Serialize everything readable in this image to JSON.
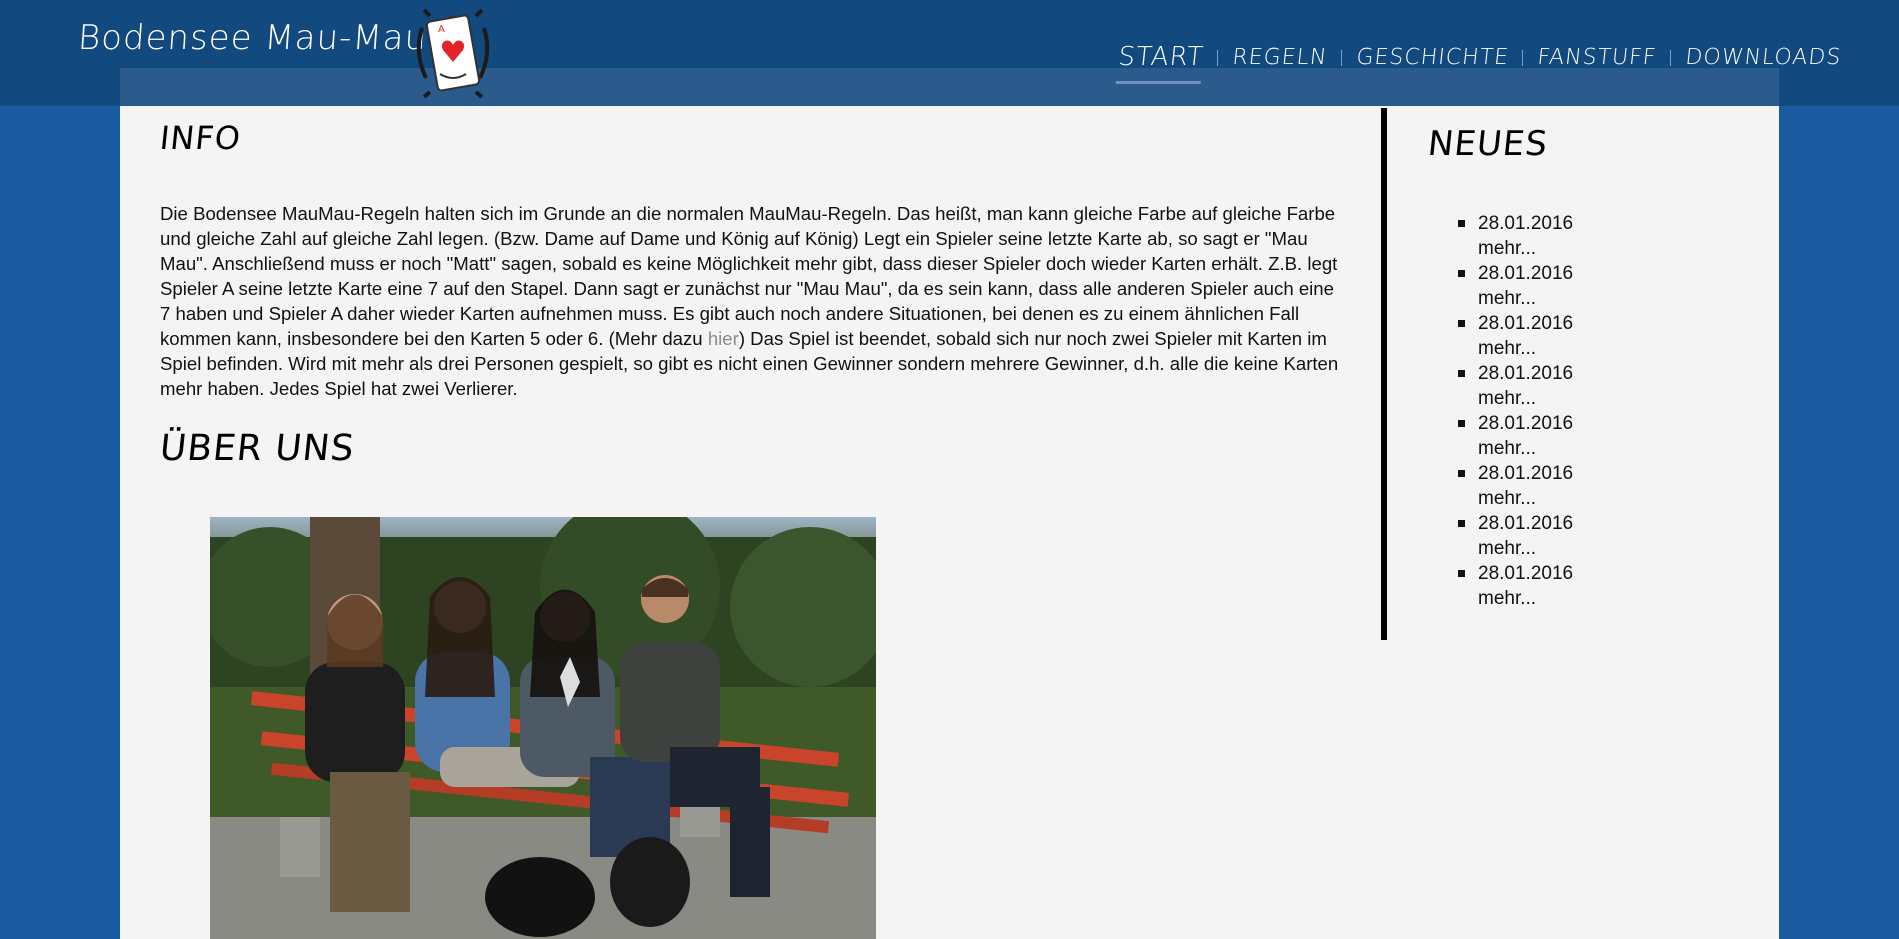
{
  "site": {
    "logo_text": "Bodensee Mau-Mau"
  },
  "nav": {
    "items": [
      {
        "label": "START",
        "active": true
      },
      {
        "label": "REGELN",
        "active": false
      },
      {
        "label": "GESCHICHTE",
        "active": false
      },
      {
        "label": "FANSTUFF",
        "active": false
      },
      {
        "label": "DOWNLOADS",
        "active": false
      }
    ]
  },
  "main": {
    "info_title": "INFO",
    "info_text_before_link": "Die Bodensee MauMau-Regeln halten sich im Grunde an die normalen MauMau-Regeln. Das heißt, man kann gleiche Farbe auf glei­che Farbe und gleiche Zahl auf gleiche Zahl legen. (Bzw. Dame auf Dame und König auf König) Legt ein Spieler seine letzte Karte ab, so sagt er \"Mau Mau\". Anschließend muss er noch \"Matt\" sagen, sobald es keine Möglichkeit mehr gibt, dass dieser Spieler doch wieder Karten erhält. Z.B. legt Spieler A seine letzte Karte eine 7 auf den Stapel. Dann sagt er zunächst nur \"Mau Mau\", da es sein kann, dass alle anderen Spieler auch eine 7 haben und Spieler A daher wieder Karten aufnehmen muss. Es gibt auch noch andere Situationen, bei denen es zu einem ähnlichen Fall kommen kann, insbesondere bei den Karten 5 oder 6. (Mehr dazu ",
    "info_link": "hier",
    "info_text_after_link": ") Das Spiel ist beendet, sobald sich nur noch zwei Spieler mit Karten im Spiel befinden. Wird mit mehr als drei Personen gespielt, so gibt es nicht einen Gewinner sondern mehrere Gewinner, d.h. alle die keine Karten mehr haben. Jedes Spiel hat zwei Verlierer.",
    "about_title": "ÜBER UNS"
  },
  "sidebar": {
    "news_title": "NEUES",
    "news": [
      {
        "date": "28.01.2016",
        "more": "mehr..."
      },
      {
        "date": "28.01.2016",
        "more": "mehr..."
      },
      {
        "date": "28.01.2016",
        "more": "mehr..."
      },
      {
        "date": "28.01.2016",
        "more": "mehr..."
      },
      {
        "date": "28.01.2016",
        "more": "mehr..."
      },
      {
        "date": "28.01.2016",
        "more": "mehr..."
      },
      {
        "date": "28.01.2016",
        "more": "mehr..."
      },
      {
        "date": "28.01.2016",
        "more": "mehr..."
      }
    ]
  },
  "colors": {
    "background": "#1a5a9e",
    "header": "#12497f",
    "content": "#f4f4f4",
    "link": "#8a8a8a",
    "card_suit": "#e0262b"
  },
  "icons": {
    "logo_card": "playing-card-heart-icon"
  }
}
